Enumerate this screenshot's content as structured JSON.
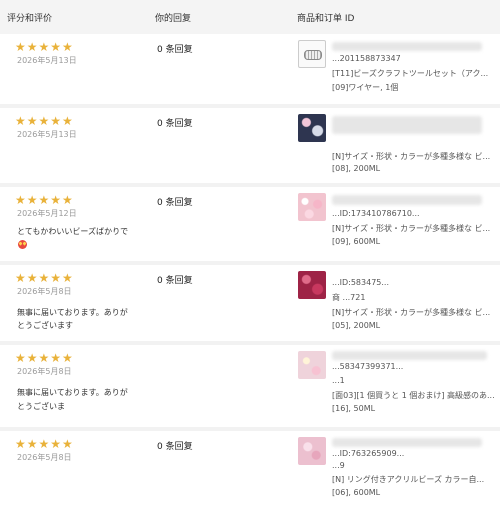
{
  "header": {
    "rating_col": "评分和评价",
    "reply_col": "你的回复",
    "product_col": "商品和订单 ID"
  },
  "rating_stars": "★★★★★",
  "reviews": [
    {
      "date": "2026年5月13日",
      "comment_lines": [],
      "replies": "0 条回复",
      "thumbnail": "bead-tool-set",
      "product_lines": [
        "...201158873347",
        "[T11]ビーズクラフトツールセット（アク...",
        "[09]ワイヤー, 1個"
      ]
    },
    {
      "date": "2026年5月13日",
      "comment_lines": [],
      "replies": "0 条回复",
      "thumbnail": "dark-beads",
      "product_lines": [
        "",
        "[N]サイズ・形状・カラーが多種多様な ビ...",
        "[08], 200ML"
      ]
    },
    {
      "date": "2026年5月12日",
      "comment_lines": [
        "とてもかわいいビーズばかりで"
      ],
      "replies": "0 条回复",
      "thumbnail": "pink-beads",
      "product_lines": [
        "...ID:173410786710...",
        "[N]サイズ・形状・カラーが多種多様な ビ...",
        "[09], 600ML"
      ]
    },
    {
      "date": "2026年5月8日",
      "comment_lines": [
        "無事に届いております。ありが",
        "とうございます"
      ],
      "replies": "0 条回复",
      "thumbnail": "red-beads",
      "product_lines": [
        "...ID:583475...",
        "商 ...721",
        "[N]サイズ・形状・カラーが多種多様な ビ...",
        "[05], 200ML"
      ]
    },
    {
      "date": "2026年5月8日",
      "comment_lines": [
        "無事に届いております。ありが",
        "とうございま"
      ],
      "replies": "",
      "thumbnail": "pastel-beads",
      "product_lines": [
        "...58347399371...",
        "...1",
        "[面03][1 個買うと 1 個おまけ] 高級感のあ...",
        "[16], 50ML"
      ]
    },
    {
      "date": "2026年5月8日",
      "comment_lines": [],
      "replies": "0 条回复",
      "thumbnail": "ring-beads",
      "product_lines": [
        "...ID:763265909...",
        "...9",
        "[N] リング付きアクリルビーズ カラー自...",
        "[06], 600ML"
      ]
    }
  ]
}
